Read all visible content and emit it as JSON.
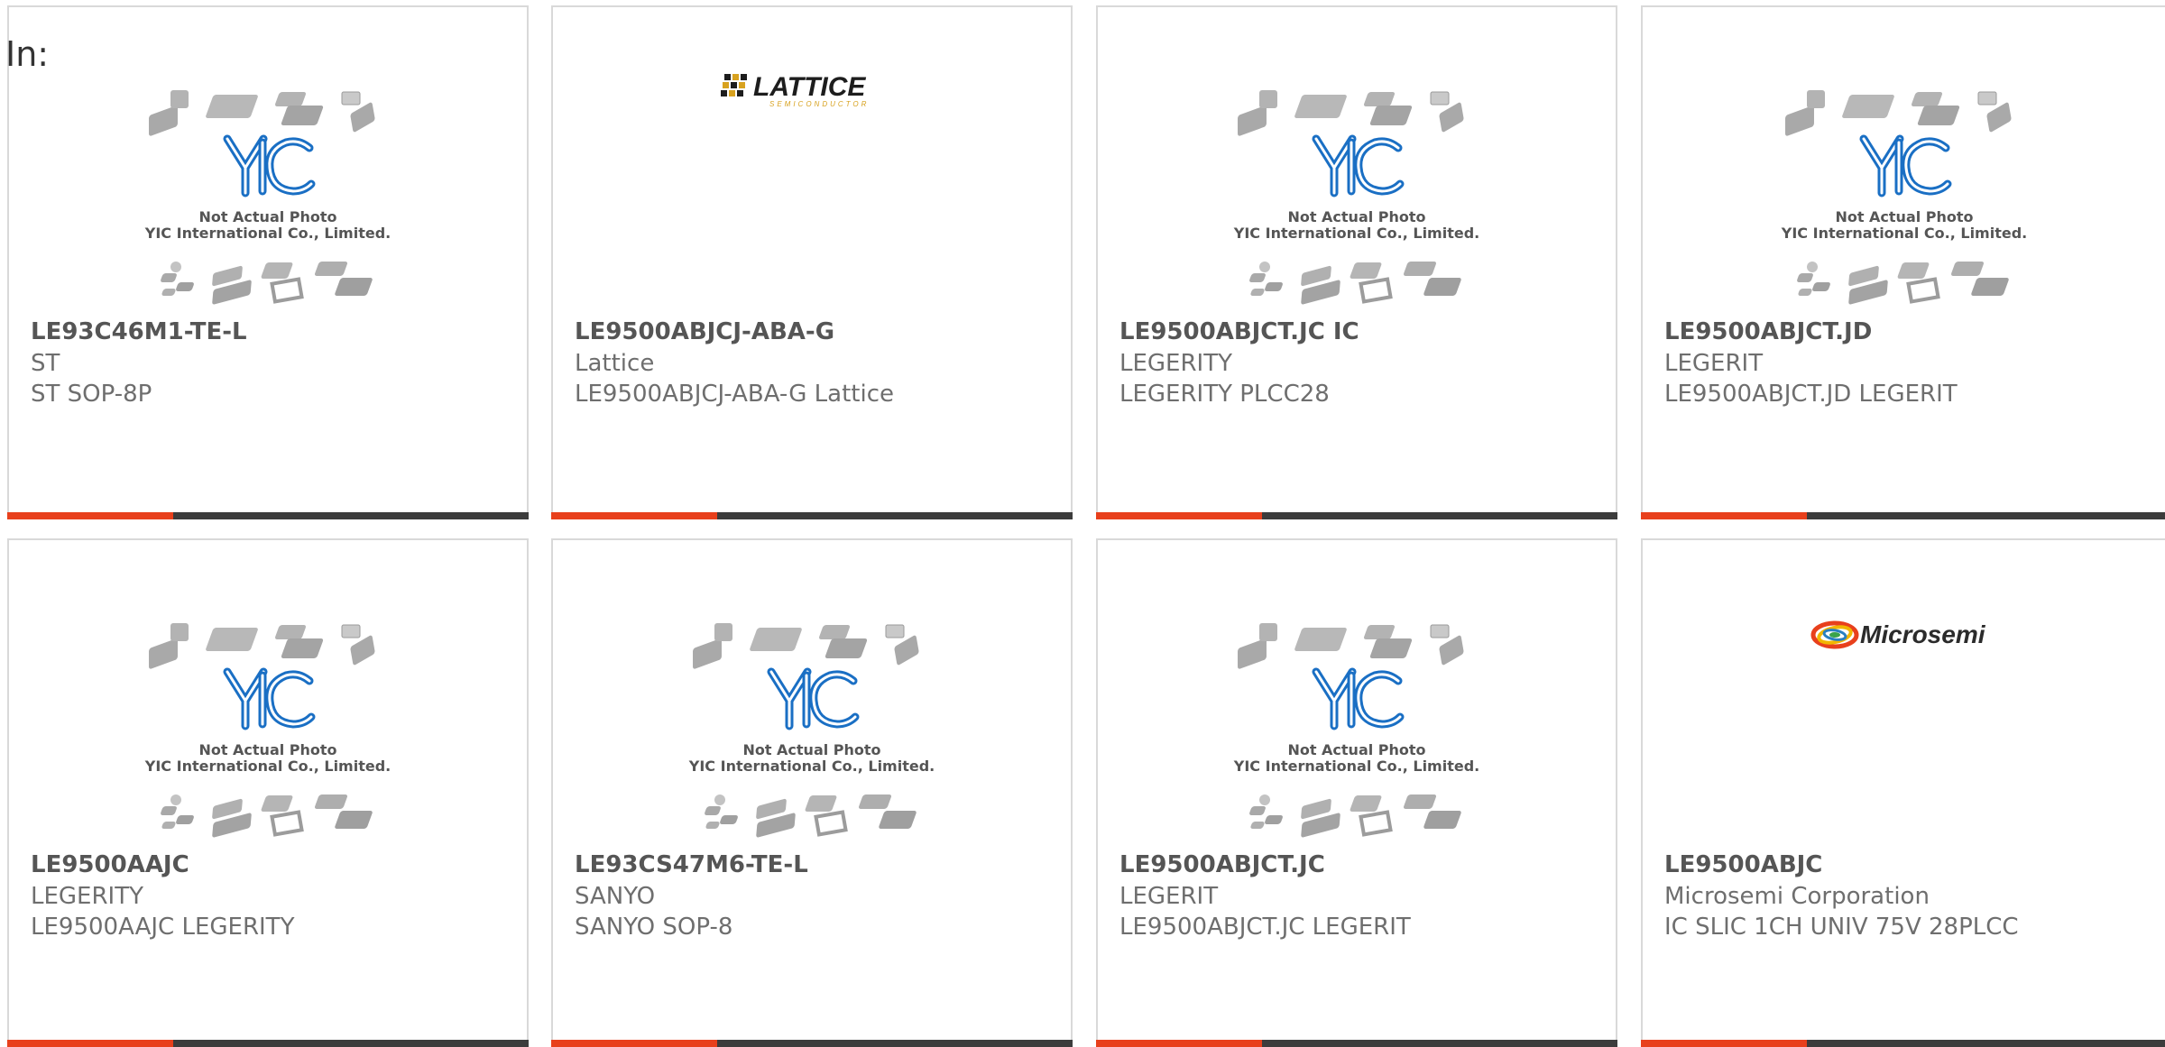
{
  "header": {
    "label": "In:"
  },
  "colors": {
    "accent": "#e8401c",
    "bar": "#3c3c3c",
    "border": "#d9d9d9",
    "yic_blue": "#1a6fc4"
  },
  "cards": [
    {
      "part": "LE93C46M1-TE-L",
      "manufacturer": "ST",
      "description": "ST SOP-8P",
      "image": "placeholder",
      "photo_note": "Not Actual Photo",
      "photo_company": "YIC International Co., Limited."
    },
    {
      "part": "LE9500ABJCJ-ABA-G",
      "manufacturer": "Lattice",
      "description": "LE9500ABJCJ-ABA-G Lattice",
      "image": "lattice-logo",
      "logo_text": "LATTICE",
      "logo_sub": "SEMICONDUCTOR"
    },
    {
      "part": "LE9500ABJCT.JC IC",
      "manufacturer": "LEGERITY",
      "description": "LEGERITY PLCC28",
      "image": "placeholder",
      "photo_note": "Not Actual Photo",
      "photo_company": "YIC International Co., Limited."
    },
    {
      "part": "LE9500ABJCT.JD",
      "manufacturer": "LEGERIT",
      "description": "LE9500ABJCT.JD LEGERIT",
      "image": "placeholder",
      "photo_note": "Not Actual Photo",
      "photo_company": "YIC International Co., Limited."
    },
    {
      "part": "LE9500AAJC",
      "manufacturer": "LEGERITY",
      "description": "LE9500AAJC LEGERITY",
      "image": "placeholder",
      "photo_note": "Not Actual Photo",
      "photo_company": "YIC International Co., Limited."
    },
    {
      "part": "LE93CS47M6-TE-L",
      "manufacturer": "SANYO",
      "description": "SANYO SOP-8",
      "image": "placeholder",
      "photo_note": "Not Actual Photo",
      "photo_company": "YIC International Co., Limited."
    },
    {
      "part": "LE9500ABJCT.JC",
      "manufacturer": "LEGERIT",
      "description": "LE9500ABJCT.JC LEGERIT",
      "image": "placeholder",
      "photo_note": "Not Actual Photo",
      "photo_company": "YIC International Co., Limited."
    },
    {
      "part": "LE9500ABJC",
      "manufacturer": "Microsemi Corporation",
      "description": "IC SLIC 1CH UNIV 75V 28PLCC",
      "image": "microsemi-logo",
      "logo_text": "Microsemi"
    }
  ]
}
